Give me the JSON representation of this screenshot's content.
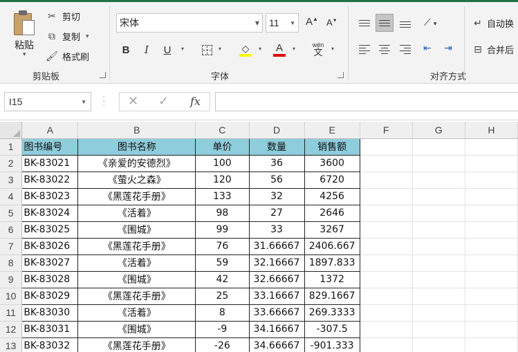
{
  "ribbon": {
    "clipboard": {
      "paste_label": "粘贴",
      "cut_label": "剪切",
      "copy_label": "复制",
      "format_painter_label": "格式刷",
      "group_label": "剪贴板"
    },
    "font": {
      "font_name": "宋体",
      "font_size": "11",
      "group_label": "字体",
      "bold": "B",
      "italic": "I",
      "underline": "U",
      "wen": "wén",
      "wen_char": "文",
      "grow": "A",
      "shrink": "A",
      "font_color_glyph": "A",
      "font_color": "#e00000",
      "fill_color": "#ffff00"
    },
    "alignment": {
      "wrap_text_label": "自动换",
      "merge_label": "合并后",
      "group_label": "对齐方式"
    }
  },
  "formula_bar": {
    "name_box": "I15",
    "fx": "fx",
    "cancel": "✕",
    "enter": "✓",
    "formula": ""
  },
  "sheet": {
    "columns": [
      "A",
      "B",
      "C",
      "D",
      "E",
      "F",
      "G",
      "H"
    ],
    "rows": [
      {
        "num": "1",
        "cells": [
          "图书编号",
          "图书名称",
          "单价",
          "数量",
          "销售额"
        ]
      },
      {
        "num": "2",
        "cells": [
          "BK-83021",
          "《亲爱的安德烈》",
          "100",
          "36",
          "3600"
        ]
      },
      {
        "num": "3",
        "cells": [
          "BK-83022",
          "《萤火之森》",
          "120",
          "56",
          "6720"
        ]
      },
      {
        "num": "4",
        "cells": [
          "BK-83023",
          "《黑莲花手册》",
          "133",
          "32",
          "4256"
        ]
      },
      {
        "num": "5",
        "cells": [
          "BK-83024",
          "《活着》",
          "98",
          "27",
          "2646"
        ]
      },
      {
        "num": "6",
        "cells": [
          "BK-83025",
          "《围城》",
          "99",
          "33",
          "3267"
        ]
      },
      {
        "num": "7",
        "cells": [
          "BK-83026",
          "《黑莲花手册》",
          "76",
          "31.66667",
          "2406.667"
        ]
      },
      {
        "num": "8",
        "cells": [
          "BK-83027",
          "《活着》",
          "59",
          "32.16667",
          "1897.833"
        ]
      },
      {
        "num": "9",
        "cells": [
          "BK-83028",
          "《围城》",
          "42",
          "32.66667",
          "1372"
        ]
      },
      {
        "num": "10",
        "cells": [
          "BK-83029",
          "《黑莲花手册》",
          "25",
          "33.16667",
          "829.1667"
        ]
      },
      {
        "num": "11",
        "cells": [
          "BK-83030",
          "《活着》",
          "8",
          "33.66667",
          "269.3333"
        ]
      },
      {
        "num": "12",
        "cells": [
          "BK-83031",
          "《围城》",
          "-9",
          "34.16667",
          "-307.5"
        ]
      },
      {
        "num": "13",
        "cells": [
          "BK-83032",
          "《黑莲花手册》",
          "-26",
          "34.66667",
          "-901.333"
        ]
      }
    ],
    "header_fill": "#8ecddb"
  }
}
